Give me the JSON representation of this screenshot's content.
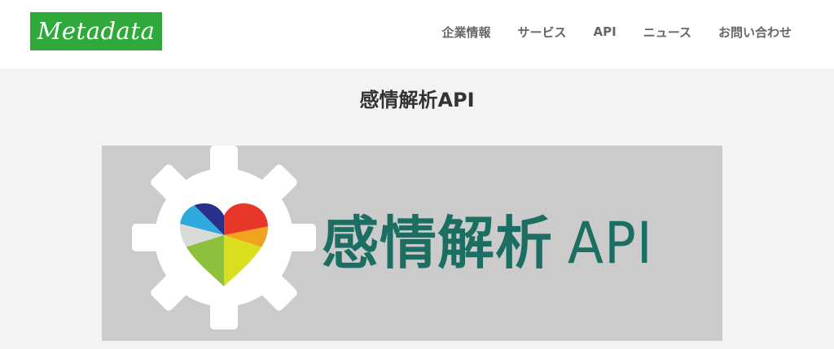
{
  "header": {
    "logo_text": "Metadata",
    "logo_color": "#2faa3a",
    "nav": [
      {
        "label": "企業情報"
      },
      {
        "label": "サービス"
      },
      {
        "label": "API"
      },
      {
        "label": "ニュース"
      },
      {
        "label": "お問い合わせ"
      }
    ]
  },
  "main": {
    "title": "感情解析API",
    "banner": {
      "title_text": "感情解析",
      "title_api": "API",
      "title_color": "#1c6e63",
      "logo_icon": "gear-heart-icon"
    }
  }
}
